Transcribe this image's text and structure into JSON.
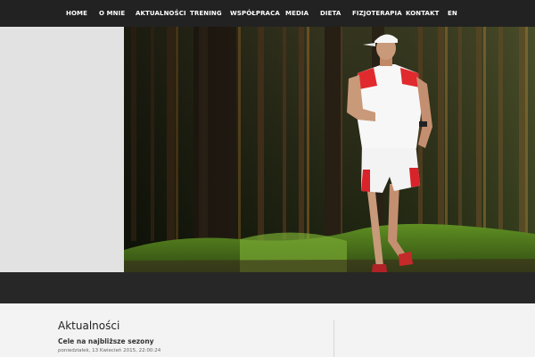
{
  "nav": {
    "items": [
      {
        "label": "HOME"
      },
      {
        "label": "O MNIE"
      },
      {
        "label": "AKTUALNOŚCI"
      },
      {
        "label": "TRENING"
      },
      {
        "label": "WSPÓŁPRACA"
      },
      {
        "label": "MEDIA"
      },
      {
        "label": "DIETA"
      },
      {
        "label": "FIZJOTERAPIA"
      },
      {
        "label": "KONTAKT"
      },
      {
        "label": "EN"
      }
    ]
  },
  "hero": {
    "image": "runner-in-forest-photo"
  },
  "news": {
    "section_title": "Aktualności",
    "article_title": "Cele na najbliższe sezony",
    "article_date": "poniedziałek, 13 Kwiecień 2015, 22:00:24"
  },
  "colors": {
    "nav_bg": "#222222",
    "band_bg": "#272727",
    "content_bg": "#f3f3f3"
  }
}
